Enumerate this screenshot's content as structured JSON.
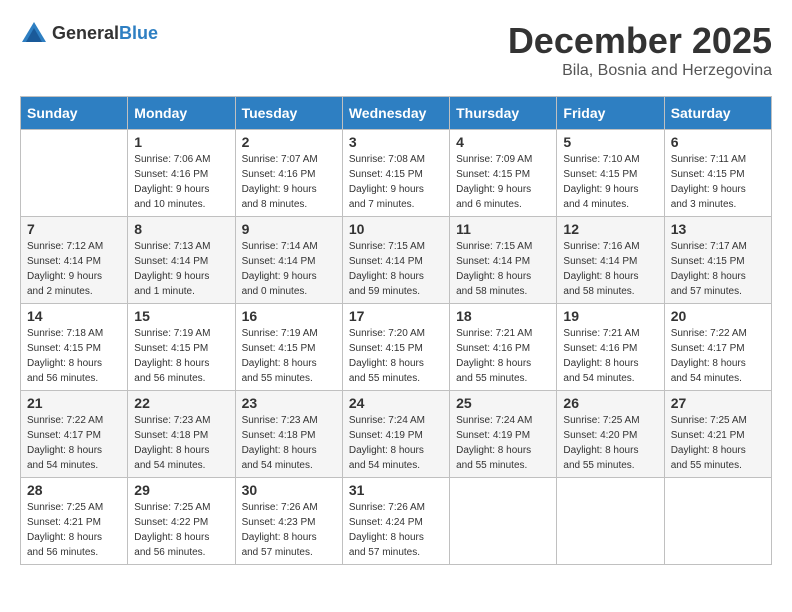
{
  "header": {
    "logo_general": "General",
    "logo_blue": "Blue",
    "month_year": "December 2025",
    "location": "Bila, Bosnia and Herzegovina"
  },
  "days_of_week": [
    "Sunday",
    "Monday",
    "Tuesday",
    "Wednesday",
    "Thursday",
    "Friday",
    "Saturday"
  ],
  "weeks": [
    [
      {
        "day": "",
        "sunrise": "",
        "sunset": "",
        "daylight": ""
      },
      {
        "day": "1",
        "sunrise": "Sunrise: 7:06 AM",
        "sunset": "Sunset: 4:16 PM",
        "daylight": "Daylight: 9 hours and 10 minutes."
      },
      {
        "day": "2",
        "sunrise": "Sunrise: 7:07 AM",
        "sunset": "Sunset: 4:16 PM",
        "daylight": "Daylight: 9 hours and 8 minutes."
      },
      {
        "day": "3",
        "sunrise": "Sunrise: 7:08 AM",
        "sunset": "Sunset: 4:15 PM",
        "daylight": "Daylight: 9 hours and 7 minutes."
      },
      {
        "day": "4",
        "sunrise": "Sunrise: 7:09 AM",
        "sunset": "Sunset: 4:15 PM",
        "daylight": "Daylight: 9 hours and 6 minutes."
      },
      {
        "day": "5",
        "sunrise": "Sunrise: 7:10 AM",
        "sunset": "Sunset: 4:15 PM",
        "daylight": "Daylight: 9 hours and 4 minutes."
      },
      {
        "day": "6",
        "sunrise": "Sunrise: 7:11 AM",
        "sunset": "Sunset: 4:15 PM",
        "daylight": "Daylight: 9 hours and 3 minutes."
      }
    ],
    [
      {
        "day": "7",
        "sunrise": "Sunrise: 7:12 AM",
        "sunset": "Sunset: 4:14 PM",
        "daylight": "Daylight: 9 hours and 2 minutes."
      },
      {
        "day": "8",
        "sunrise": "Sunrise: 7:13 AM",
        "sunset": "Sunset: 4:14 PM",
        "daylight": "Daylight: 9 hours and 1 minute."
      },
      {
        "day": "9",
        "sunrise": "Sunrise: 7:14 AM",
        "sunset": "Sunset: 4:14 PM",
        "daylight": "Daylight: 9 hours and 0 minutes."
      },
      {
        "day": "10",
        "sunrise": "Sunrise: 7:15 AM",
        "sunset": "Sunset: 4:14 PM",
        "daylight": "Daylight: 8 hours and 59 minutes."
      },
      {
        "day": "11",
        "sunrise": "Sunrise: 7:15 AM",
        "sunset": "Sunset: 4:14 PM",
        "daylight": "Daylight: 8 hours and 58 minutes."
      },
      {
        "day": "12",
        "sunrise": "Sunrise: 7:16 AM",
        "sunset": "Sunset: 4:14 PM",
        "daylight": "Daylight: 8 hours and 58 minutes."
      },
      {
        "day": "13",
        "sunrise": "Sunrise: 7:17 AM",
        "sunset": "Sunset: 4:15 PM",
        "daylight": "Daylight: 8 hours and 57 minutes."
      }
    ],
    [
      {
        "day": "14",
        "sunrise": "Sunrise: 7:18 AM",
        "sunset": "Sunset: 4:15 PM",
        "daylight": "Daylight: 8 hours and 56 minutes."
      },
      {
        "day": "15",
        "sunrise": "Sunrise: 7:19 AM",
        "sunset": "Sunset: 4:15 PM",
        "daylight": "Daylight: 8 hours and 56 minutes."
      },
      {
        "day": "16",
        "sunrise": "Sunrise: 7:19 AM",
        "sunset": "Sunset: 4:15 PM",
        "daylight": "Daylight: 8 hours and 55 minutes."
      },
      {
        "day": "17",
        "sunrise": "Sunrise: 7:20 AM",
        "sunset": "Sunset: 4:15 PM",
        "daylight": "Daylight: 8 hours and 55 minutes."
      },
      {
        "day": "18",
        "sunrise": "Sunrise: 7:21 AM",
        "sunset": "Sunset: 4:16 PM",
        "daylight": "Daylight: 8 hours and 55 minutes."
      },
      {
        "day": "19",
        "sunrise": "Sunrise: 7:21 AM",
        "sunset": "Sunset: 4:16 PM",
        "daylight": "Daylight: 8 hours and 54 minutes."
      },
      {
        "day": "20",
        "sunrise": "Sunrise: 7:22 AM",
        "sunset": "Sunset: 4:17 PM",
        "daylight": "Daylight: 8 hours and 54 minutes."
      }
    ],
    [
      {
        "day": "21",
        "sunrise": "Sunrise: 7:22 AM",
        "sunset": "Sunset: 4:17 PM",
        "daylight": "Daylight: 8 hours and 54 minutes."
      },
      {
        "day": "22",
        "sunrise": "Sunrise: 7:23 AM",
        "sunset": "Sunset: 4:18 PM",
        "daylight": "Daylight: 8 hours and 54 minutes."
      },
      {
        "day": "23",
        "sunrise": "Sunrise: 7:23 AM",
        "sunset": "Sunset: 4:18 PM",
        "daylight": "Daylight: 8 hours and 54 minutes."
      },
      {
        "day": "24",
        "sunrise": "Sunrise: 7:24 AM",
        "sunset": "Sunset: 4:19 PM",
        "daylight": "Daylight: 8 hours and 54 minutes."
      },
      {
        "day": "25",
        "sunrise": "Sunrise: 7:24 AM",
        "sunset": "Sunset: 4:19 PM",
        "daylight": "Daylight: 8 hours and 55 minutes."
      },
      {
        "day": "26",
        "sunrise": "Sunrise: 7:25 AM",
        "sunset": "Sunset: 4:20 PM",
        "daylight": "Daylight: 8 hours and 55 minutes."
      },
      {
        "day": "27",
        "sunrise": "Sunrise: 7:25 AM",
        "sunset": "Sunset: 4:21 PM",
        "daylight": "Daylight: 8 hours and 55 minutes."
      }
    ],
    [
      {
        "day": "28",
        "sunrise": "Sunrise: 7:25 AM",
        "sunset": "Sunset: 4:21 PM",
        "daylight": "Daylight: 8 hours and 56 minutes."
      },
      {
        "day": "29",
        "sunrise": "Sunrise: 7:25 AM",
        "sunset": "Sunset: 4:22 PM",
        "daylight": "Daylight: 8 hours and 56 minutes."
      },
      {
        "day": "30",
        "sunrise": "Sunrise: 7:26 AM",
        "sunset": "Sunset: 4:23 PM",
        "daylight": "Daylight: 8 hours and 57 minutes."
      },
      {
        "day": "31",
        "sunrise": "Sunrise: 7:26 AM",
        "sunset": "Sunset: 4:24 PM",
        "daylight": "Daylight: 8 hours and 57 minutes."
      },
      {
        "day": "",
        "sunrise": "",
        "sunset": "",
        "daylight": ""
      },
      {
        "day": "",
        "sunrise": "",
        "sunset": "",
        "daylight": ""
      },
      {
        "day": "",
        "sunrise": "",
        "sunset": "",
        "daylight": ""
      }
    ]
  ]
}
